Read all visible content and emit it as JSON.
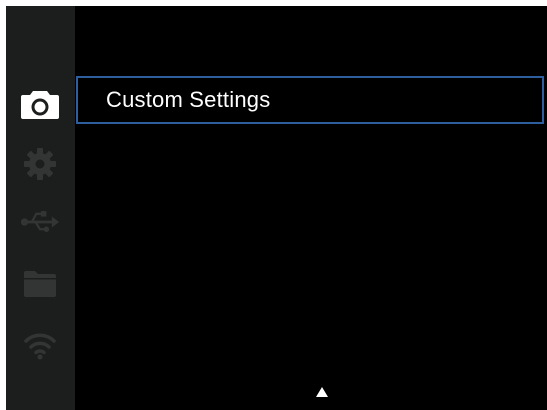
{
  "colors": {
    "screen_background": "#000000",
    "sidebar_background": "#1c1e1d",
    "active_icon": "#ffffff",
    "inactive_icon": "#333534",
    "selection_border": "#2d5f9e",
    "text": "#ffffff"
  },
  "sidebar": {
    "items": [
      {
        "icon": "camera-icon",
        "active": true
      },
      {
        "icon": "gear-icon",
        "active": false
      },
      {
        "icon": "usb-icon",
        "active": false
      },
      {
        "icon": "folder-icon",
        "active": false
      },
      {
        "icon": "wifi-icon",
        "active": false
      }
    ]
  },
  "menu": {
    "items": [
      {
        "label": "Custom Settings",
        "selected": true
      }
    ]
  },
  "footer": {
    "scroll_indicator": "up-arrow-icon"
  }
}
